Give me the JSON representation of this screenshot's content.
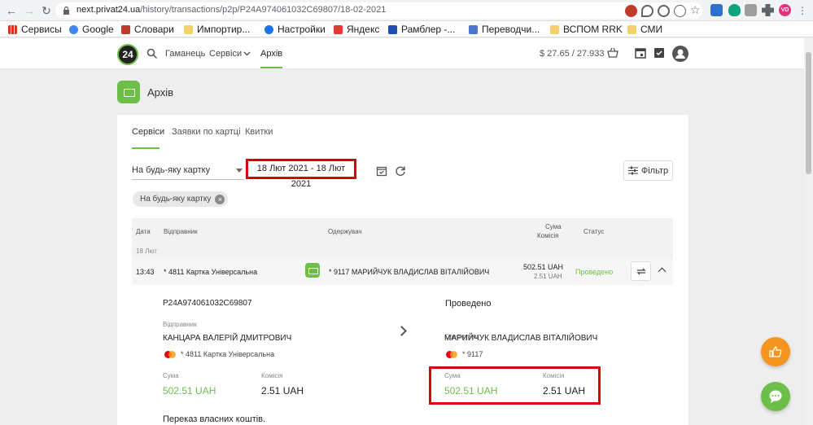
{
  "browser": {
    "url_host": "next.privat24.ua",
    "url_path": "/history/transactions/p2p/P24A974061032C69807/18-02-2021",
    "profile_initials": "VD",
    "bookmarks": [
      {
        "label": "Сервисы",
        "icon": "apps-grid-icon"
      },
      {
        "label": "Google",
        "icon": "google-icon"
      },
      {
        "label": "Словари",
        "icon": "bookmark-icon"
      },
      {
        "label": "Импортир...",
        "icon": "folder-icon"
      },
      {
        "label": "Настройки",
        "icon": "gear-icon"
      },
      {
        "label": "Яндекс",
        "icon": "yandex-icon"
      },
      {
        "label": "Рамблер -...",
        "icon": "rambler-icon"
      },
      {
        "label": "Переводчи...",
        "icon": "translate-icon"
      },
      {
        "label": "ВСПОМ RRK",
        "icon": "folder-icon"
      },
      {
        "label": "СМИ",
        "icon": "folder-icon"
      }
    ]
  },
  "header": {
    "logo": "24",
    "nav": [
      "Гаманець",
      "Сервіси",
      "Архів"
    ],
    "active_nav": "Архів",
    "balance": "$  27.65 / 27.933"
  },
  "page": {
    "title": "Архів",
    "tabs": [
      "Сервіси",
      "Заявки по картці",
      "Квитки"
    ],
    "active_tab": "Сервіси"
  },
  "filters": {
    "card_select": "На будь-яку картку",
    "date_range": "18 Лют 2021 - 18 Лют 2021",
    "filter_button": "Фільтр",
    "chip": "На будь-яку картку"
  },
  "table": {
    "headers": {
      "date": "Дата",
      "sender": "Відправник",
      "receiver": "Одержувач",
      "amount": "Сума",
      "commission": "Комісія",
      "status": "Статус"
    },
    "group_date": "18 Лют",
    "row": {
      "time": "13:43",
      "sender": "* 4811 Картка Універсальна",
      "receiver": "* 9117 МАРИЙЧУК ВЛАДИСЛАВ ВІТАЛІЙОВИЧ",
      "amount": "502.51 UAH",
      "commission": "2.51 UAH",
      "status": "Проведено"
    }
  },
  "details": {
    "reference": "P24A974061032C69807",
    "status": "Проведено",
    "sender_label": "Відправник",
    "sender_name": "КАНЦАРА ВАЛЕРІЙ ДМИТРОВИЧ",
    "sender_card": "* 4811 Картка Універсальна",
    "receiver_label": "Одержувач",
    "receiver_name": "МАРИЙЧУК ВЛАДИСЛАВ ВІТАЛІЙОВИЧ",
    "receiver_card": "* 9117",
    "amount_label": "Сума",
    "commission_label": "Комісія",
    "amount": "502.51 UAH",
    "commission": "2.51 UAH",
    "purpose": "Переказ власних коштів."
  },
  "colors": {
    "accent": "#6cc04a",
    "highlight": "#d9000d",
    "fab_like": "#f5941e"
  }
}
